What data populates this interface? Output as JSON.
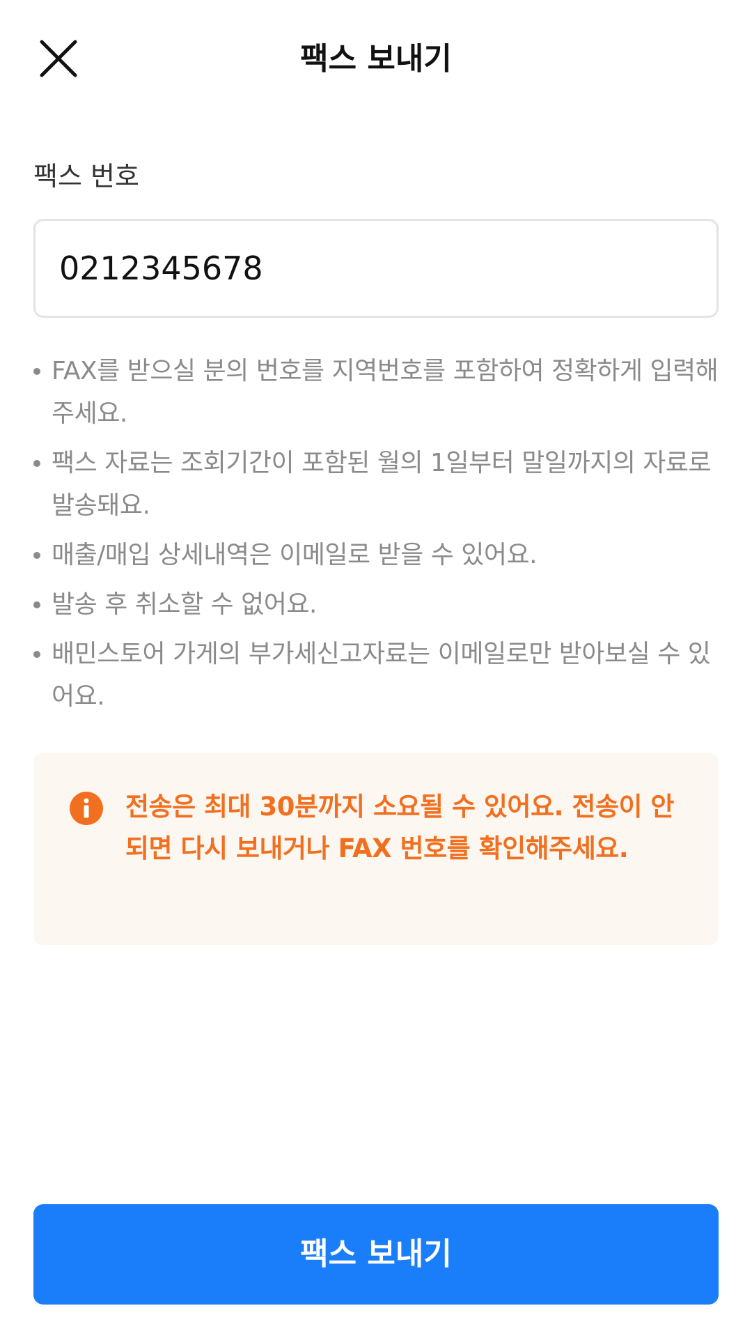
{
  "header": {
    "title": "팩스 보내기",
    "close_icon": "close-icon"
  },
  "form": {
    "label": "팩스 번호",
    "fax_number_value": "0212345678",
    "fax_number_placeholder": ""
  },
  "notes": [
    "FAX를 받으실 분의 번호를 지역번호를 포함하여 정확하게 입력해 주세요.",
    "팩스 자료는 조회기간이 포함된 월의 1일부터 말일까지의 자료로 발송돼요.",
    "매출/매입 상세내역은 이메일로 받을 수 있어요.",
    "발송 후 취소할 수 없어요.",
    "배민스토어 가게의 부가세신고자료는 이메일로만 받아보실 수 있어요."
  ],
  "notice": {
    "icon": "info-icon",
    "text": "전송은 최대 30분까지 소요될 수 있어요. 전송이 안되면 다시 보내거나 FAX 번호를 확인해주세요."
  },
  "footer": {
    "send_label": "팩스 보내기"
  },
  "colors": {
    "accent": "#1a7efb",
    "notice_text": "#f0701f",
    "notice_bg": "#fdf7f2"
  }
}
